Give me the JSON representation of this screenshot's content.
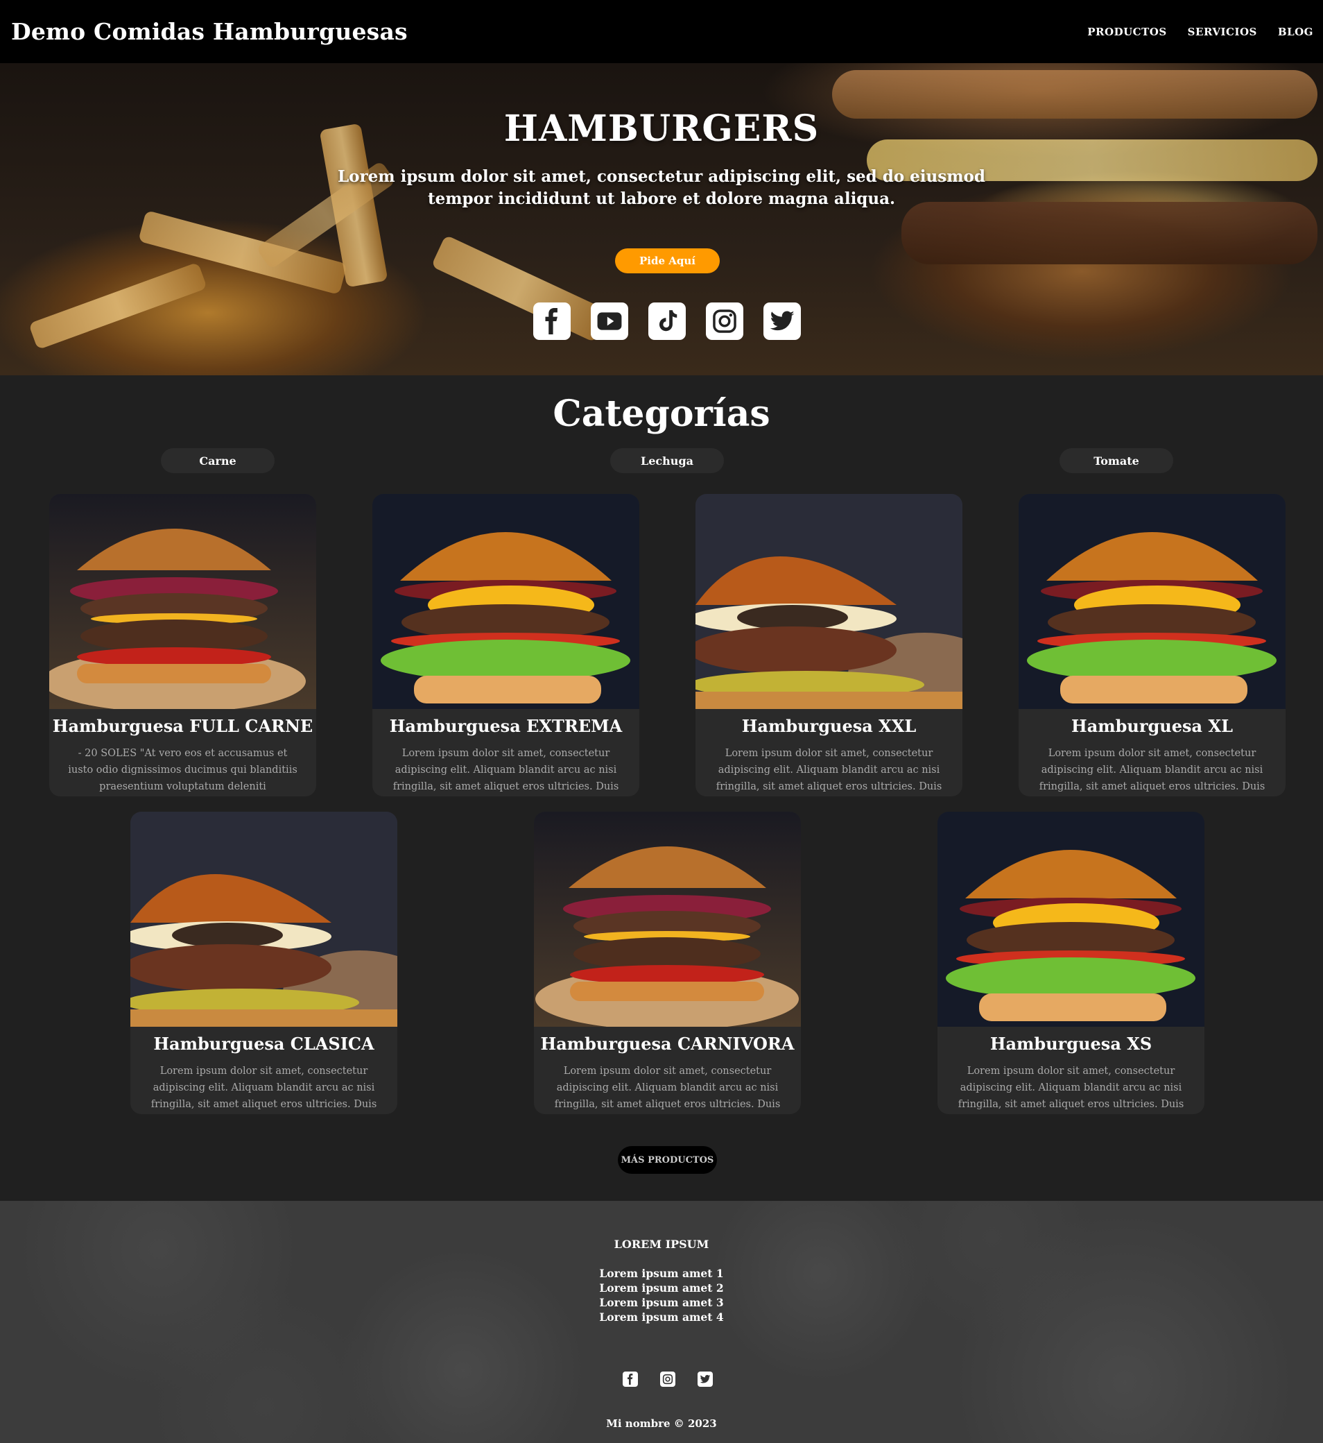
{
  "header": {
    "brand": "Demo Comidas Hamburguesas",
    "nav": [
      "PRODUCTOS",
      "SERVICIOS",
      "BLOG"
    ]
  },
  "hero": {
    "title": "HAMBURGERS",
    "subtitle": "Lorem ipsum dolor sit amet, consectetur adipiscing elit, sed do eiusmod tempor incididunt ut labore et dolore magna aliqua.",
    "cta_label": "Pide Aquí",
    "socials": [
      "facebook-icon",
      "youtube-icon",
      "tiktok-icon",
      "instagram-icon",
      "twitter-icon"
    ]
  },
  "categories": {
    "title": "Categorías",
    "chips": [
      "Carne",
      "Lechuga",
      "Tomate"
    ]
  },
  "products": [
    {
      "name": "Hamburguesa FULL CARNE",
      "desc": "- 20 SOLES   \"At vero eos et accusamus et iusto odio dignissimos ducimus qui blanditiis praesentium voluptatum deleniti"
    },
    {
      "name": "Hamburguesa EXTREMA",
      "desc": "Lorem ipsum dolor sit amet, consectetur adipiscing elit. Aliquam blandit arcu ac nisi fringilla, sit amet aliquet eros ultricies. Duis"
    },
    {
      "name": "Hamburguesa XXL",
      "desc": "Lorem ipsum dolor sit amet, consectetur adipiscing elit. Aliquam blandit arcu ac nisi fringilla, sit amet aliquet eros ultricies. Duis"
    },
    {
      "name": "Hamburguesa XL",
      "desc": "Lorem ipsum dolor sit amet, consectetur adipiscing elit. Aliquam blandit arcu ac nisi fringilla, sit amet aliquet eros ultricies. Duis"
    },
    {
      "name": "Hamburguesa CLASICA",
      "desc": "Lorem ipsum dolor sit amet, consectetur adipiscing elit. Aliquam blandit arcu ac nisi fringilla, sit amet aliquet eros ultricies. Duis"
    },
    {
      "name": "Hamburguesa CARNIVORA",
      "desc": "Lorem ipsum dolor sit amet, consectetur adipiscing elit. Aliquam blandit arcu ac nisi fringilla, sit amet aliquet eros ultricies. Duis"
    },
    {
      "name": "Hamburguesa XS",
      "desc": "Lorem ipsum dolor sit amet, consectetur adipiscing elit. Aliquam blandit arcu ac nisi fringilla, sit amet aliquet eros ultricies. Duis"
    }
  ],
  "more_button": "MÁS PRODUCTOS",
  "footer": {
    "heading": "LOREM IPSUM",
    "links": [
      "Lorem ipsum amet 1",
      "Lorem ipsum amet 2",
      "Lorem ipsum amet 3",
      "Lorem ipsum amet 4"
    ],
    "socials": [
      "facebook-icon",
      "instagram-icon",
      "twitter-icon"
    ],
    "copyright": "Mi nombre © 2023"
  },
  "colors": {
    "accent": "#ff9a00",
    "header_bg": "#000000",
    "page_bg": "#202020",
    "card_bg": "#2a2a2a",
    "footer_bg": "#3c3c3c"
  }
}
